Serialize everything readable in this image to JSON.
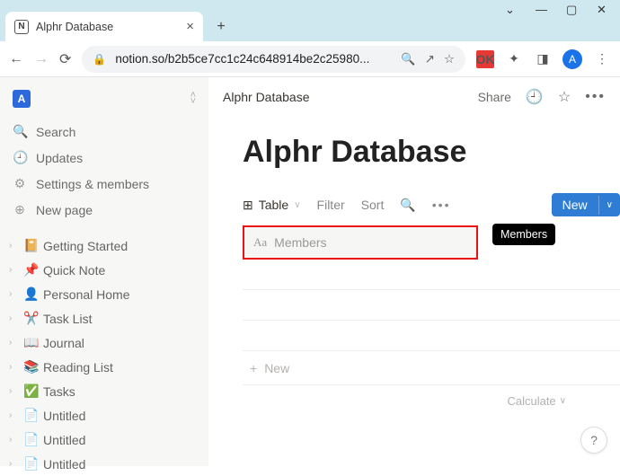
{
  "window": {
    "tab_title": "Alphr Database"
  },
  "browser": {
    "url": "notion.so/b2b5ce7cc1c24c648914be2c25980...",
    "ok_ext": "OK",
    "avatar_initial": "A"
  },
  "sidebar": {
    "workspace_initial": "A",
    "search": "Search",
    "updates": "Updates",
    "settings": "Settings & members",
    "newpage": "New page",
    "pages": [
      {
        "icon": "📔",
        "label": "Getting Started"
      },
      {
        "icon": "📌",
        "label": "Quick Note"
      },
      {
        "icon": "👤",
        "label": "Personal Home"
      },
      {
        "icon": "✂️",
        "label": "Task List"
      },
      {
        "icon": "📖",
        "label": "Journal"
      },
      {
        "icon": "📚",
        "label": "Reading List"
      },
      {
        "icon": "✅",
        "label": "Tasks"
      },
      {
        "icon": "📄",
        "label": "Untitled"
      },
      {
        "icon": "📄",
        "label": "Untitled"
      },
      {
        "icon": "📄",
        "label": "Untitled"
      }
    ]
  },
  "topbar": {
    "breadcrumb": "Alphr Database",
    "share": "Share"
  },
  "page": {
    "title": "Alphr Database"
  },
  "db": {
    "view_label": "Table",
    "filter": "Filter",
    "sort": "Sort",
    "new_label": "New",
    "property_name": "Members",
    "property_tooltip": "Members",
    "newrow": "New",
    "calculate": "Calculate"
  },
  "help": "?"
}
